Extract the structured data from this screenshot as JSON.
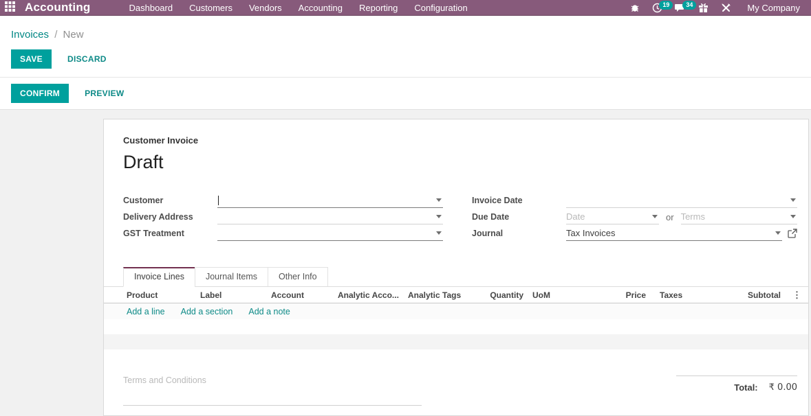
{
  "colors": {
    "topbar": "#875A7B",
    "accent": "#00A09D",
    "link": "#008784",
    "tab_active_border": "#72304f",
    "badge": "#00A09D"
  },
  "icons": {
    "apps": "grid-3x3",
    "bug": "bug",
    "activities": "clock",
    "messages": "chat-bubble",
    "gift": "gift-box",
    "tools": "crossed-tools",
    "kebab": "⋮",
    "external": "external-link",
    "dropdown": "caret-down"
  },
  "topbar": {
    "app_name": "Accounting",
    "menu": [
      "Dashboard",
      "Customers",
      "Vendors",
      "Accounting",
      "Reporting",
      "Configuration"
    ],
    "activity_badge": "19",
    "message_badge": "34",
    "company": "My Company"
  },
  "breadcrumb": {
    "parent": "Invoices",
    "separator": "/",
    "current": "New"
  },
  "actions": {
    "save": "SAVE",
    "discard": "DISCARD",
    "confirm": "CONFIRM",
    "preview": "PREVIEW"
  },
  "form": {
    "doc_type": "Customer Invoice",
    "status": "Draft",
    "fields": {
      "customer_label": "Customer",
      "delivery_address_label": "Delivery Address",
      "gst_treatment_label": "GST Treatment",
      "invoice_date_label": "Invoice Date",
      "due_date_label": "Due Date",
      "due_date_placeholder_date": "Date",
      "due_date_or": "or",
      "due_date_placeholder_terms": "Terms",
      "journal_label": "Journal",
      "journal_value": "Tax Invoices"
    },
    "tabs": [
      {
        "label": "Invoice Lines"
      },
      {
        "label": "Journal Items"
      },
      {
        "label": "Other Info"
      }
    ],
    "table": {
      "headers": [
        "Product",
        "Label",
        "Account",
        "Analytic Acco...",
        "Analytic Tags",
        "Quantity",
        "UoM",
        "Price",
        "Taxes",
        "Subtotal"
      ],
      "links": [
        "Add a line",
        "Add a section",
        "Add a note"
      ]
    },
    "notes_placeholder": "Terms and Conditions",
    "total_label": "Total:",
    "total_value": "₹ 0.00"
  }
}
